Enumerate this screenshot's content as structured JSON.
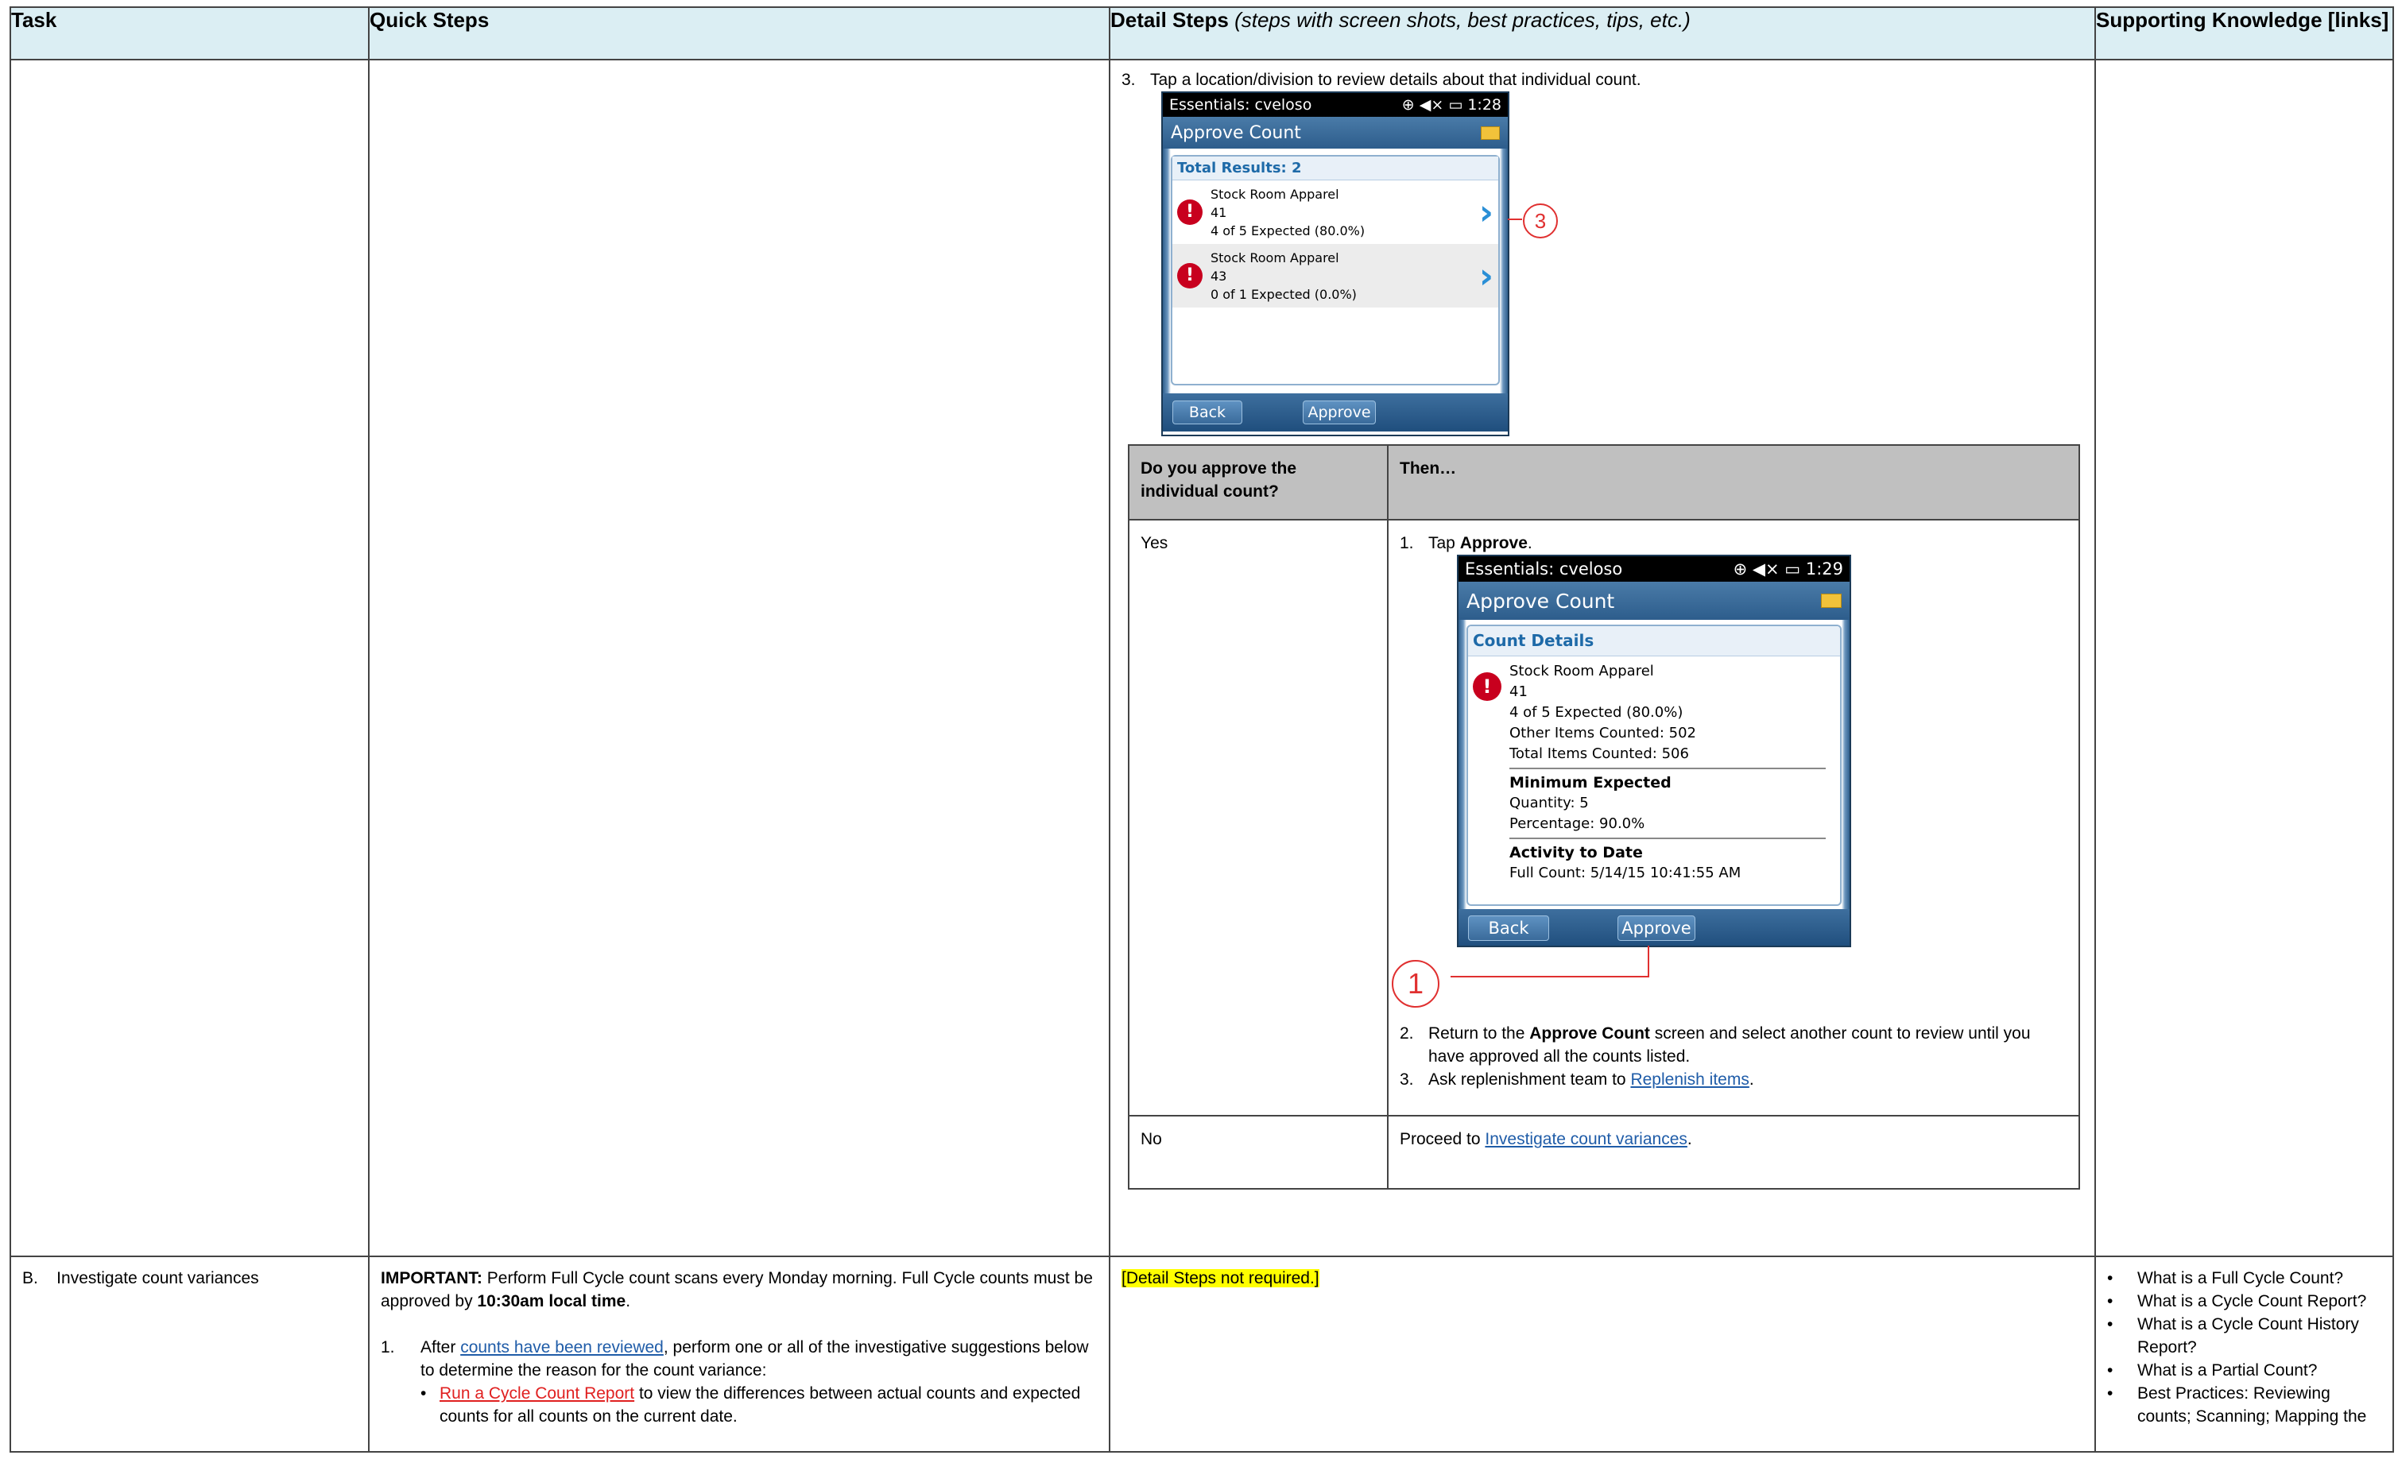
{
  "headers": {
    "task": "Task",
    "quick": "Quick Steps",
    "detail_bold": "Detail Steps",
    "detail_italic": "(steps with screen shots, best practices, tips, etc.)",
    "support": "Supporting Knowledge [links]"
  },
  "row1": {
    "step3_num": "3.",
    "step3_text": "Tap a location/division to review details about that individual count.",
    "phone1": {
      "status_left": "Essentials: cveloso",
      "status_right": "1:28",
      "title": "Approve Count",
      "panel_header": "Total Results: 2",
      "items": [
        {
          "line1": "Stock Room Apparel",
          "line2": "41",
          "line3": "4 of 5 Expected (80.0%)"
        },
        {
          "line1": "Stock Room Apparel",
          "line2": "43",
          "line3": "0 of 1 Expected (0.0%)"
        }
      ],
      "back": "Back",
      "approve": "Approve",
      "callout": "3"
    },
    "decision": {
      "h1": "Do you approve the individual count?",
      "h2": "Then…",
      "yes": "Yes",
      "no": "No",
      "yes_s1_num": "1.",
      "yes_s1_pre": "Tap ",
      "yes_s1_bold": "Approve",
      "yes_s1_post": ".",
      "yes_s2_num": "2.",
      "yes_s2_pre": "Return to the ",
      "yes_s2_bold": "Approve Count",
      "yes_s2_post": " screen and select another count to review until you have approved all the counts listed.",
      "yes_s3_num": "3.",
      "yes_s3_pre": "Ask replenishment team to ",
      "yes_s3_link": "Replenish items",
      "yes_s3_post": ".",
      "no_pre": "Proceed to ",
      "no_link": "Investigate count variances",
      "no_post": "."
    },
    "phone2": {
      "status_left": "Essentials: cveloso",
      "status_right": "1:29",
      "title": "Approve Count",
      "panel_header": "Count Details",
      "d1": "Stock Room Apparel",
      "d2": "41",
      "d3": "4 of 5 Expected (80.0%)",
      "d4": "Other Items Counted: 502",
      "d5": "Total Items Counted: 506",
      "min_title": "Minimum Expected",
      "min_q": "Quantity: 5",
      "min_p": "Percentage: 90.0%",
      "act_title": "Activity to Date",
      "act_full": "Full Count: 5/14/15 10:41:55 AM",
      "back": "Back",
      "approve": "Approve",
      "callout": "1"
    }
  },
  "row2": {
    "task": "B.    Investigate count variances",
    "important_label": "IMPORTANT:",
    "important_text": " Perform Full Cycle count scans every Monday morning. Full Cycle counts must be approved by ",
    "important_time": "10:30am local time",
    "important_end": ".",
    "s1_num": "1.",
    "s1_pre": "After ",
    "s1_link": "counts have been reviewed",
    "s1_post": ", perform one or all of the investigative suggestions below to determine the reason for the count variance:",
    "b1_link": "Run a Cycle Count Report",
    "b1_post": " to view the differences between actual counts and expected counts for all counts on the current date.",
    "detail": "[Detail Steps not required.]",
    "support": [
      "What is a Full Cycle Count?",
      "What is a Cycle Count Report?",
      "What is a Cycle Count History Report?",
      "What is a Partial Count?",
      "Best Practices: Reviewing counts; Scanning; Mapping the"
    ]
  }
}
